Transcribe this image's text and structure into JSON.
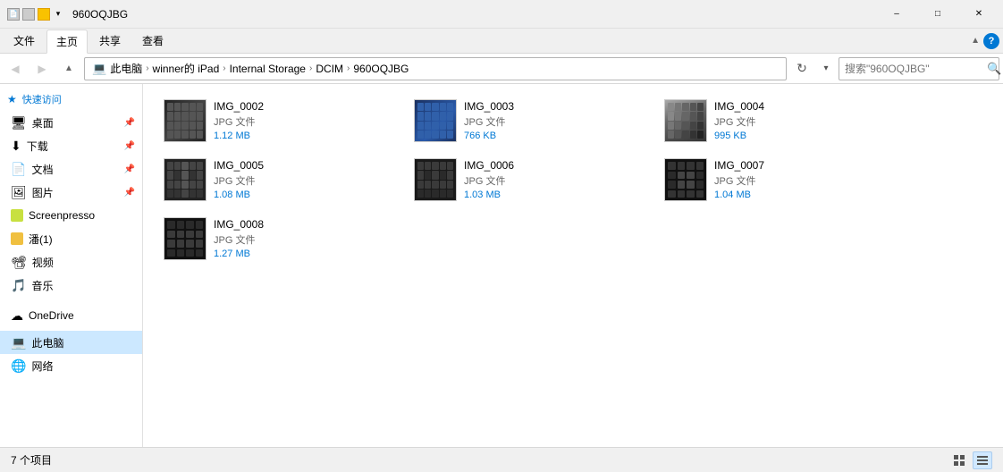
{
  "titleBar": {
    "title": "960OQJBG",
    "minimizeLabel": "–",
    "maximizeLabel": "□",
    "closeLabel": "✕"
  },
  "ribbon": {
    "tabs": [
      "文件",
      "主页",
      "共享",
      "查看"
    ]
  },
  "addressBar": {
    "backTooltip": "后退",
    "forwardTooltip": "前进",
    "upTooltip": "向上",
    "pathParts": [
      "此电脑",
      "winner的 iPad",
      "Internal Storage",
      "DCIM",
      "960OQJBG"
    ],
    "refreshTooltip": "刷新",
    "searchPlaceholder": "搜索\"960OQJBG\"",
    "downArrow": "▼"
  },
  "sidebar": {
    "quickAccess": "★ 快速访问",
    "items": [
      {
        "id": "desktop",
        "label": "桌面",
        "pinned": true
      },
      {
        "id": "download",
        "label": "下载",
        "pinned": true
      },
      {
        "id": "documents",
        "label": "文档",
        "pinned": true
      },
      {
        "id": "pictures",
        "label": "图片",
        "pinned": true
      },
      {
        "id": "screenpresso",
        "label": "Screenpresso"
      },
      {
        "id": "pan",
        "label": "潘(1)"
      },
      {
        "id": "video",
        "label": "视频"
      },
      {
        "id": "music",
        "label": "音乐"
      }
    ],
    "onedrive": "OneDrive",
    "computer": "此电脑",
    "network": "网络"
  },
  "files": [
    {
      "id": "img0002",
      "name": "IMG_0002",
      "type": "JPG 文件",
      "size": "1.12 MB",
      "thumbStyle": "dark"
    },
    {
      "id": "img0003",
      "name": "IMG_0003",
      "type": "JPG 文件",
      "size": "766 KB",
      "thumbStyle": "blue"
    },
    {
      "id": "img0004",
      "name": "IMG_0004",
      "type": "JPG 文件",
      "size": "995 KB",
      "thumbStyle": "mixed"
    },
    {
      "id": "img0005",
      "name": "IMG_0005",
      "type": "JPG 文件",
      "size": "1.08 MB",
      "thumbStyle": "dark"
    },
    {
      "id": "img0006",
      "name": "IMG_0006",
      "type": "JPG 文件",
      "size": "1.03 MB",
      "thumbStyle": "dark2"
    },
    {
      "id": "img0007",
      "name": "IMG_0007",
      "type": "JPG 文件",
      "size": "1.04 MB",
      "thumbStyle": "dark3"
    },
    {
      "id": "img0008",
      "name": "IMG_0008",
      "type": "JPG 文件",
      "size": "1.27 MB",
      "thumbStyle": "dark4"
    }
  ],
  "statusBar": {
    "itemCount": "7 个项目"
  }
}
